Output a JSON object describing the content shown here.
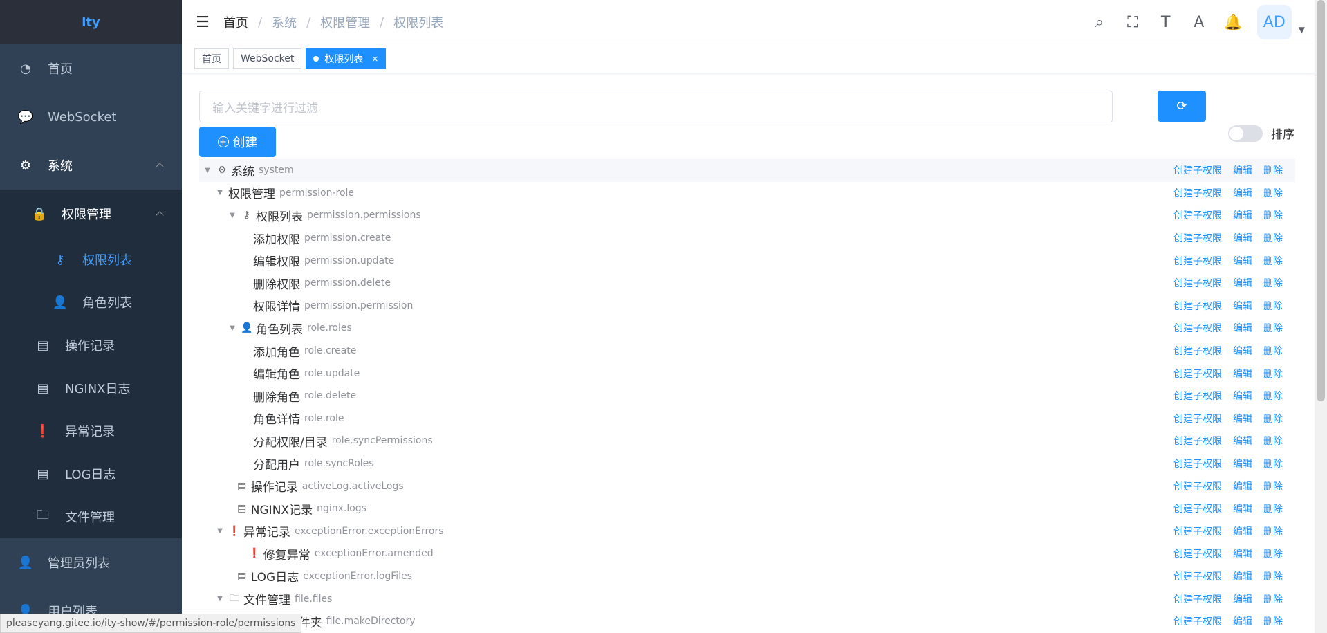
{
  "sidebar": {
    "logo": "lty",
    "items": [
      {
        "label": "首页",
        "icon": "dashboard-icon"
      },
      {
        "label": "WebSocket",
        "icon": "chat-icon"
      },
      {
        "label": "系统",
        "icon": "gear-icon"
      },
      {
        "label": "权限管理",
        "icon": "lock-icon"
      },
      {
        "label": "权限列表",
        "icon": "key-icon"
      },
      {
        "label": "角色列表",
        "icon": "user-icon"
      },
      {
        "label": "操作记录",
        "icon": "document-icon"
      },
      {
        "label": "NGINX日志",
        "icon": "document-icon"
      },
      {
        "label": "异常记录",
        "icon": "warning-icon"
      },
      {
        "label": "LOG日志",
        "icon": "document-icon"
      },
      {
        "label": "文件管理",
        "icon": "folder-icon"
      },
      {
        "label": "管理员列表",
        "icon": "user-icon"
      },
      {
        "label": "用户列表",
        "icon": "user-icon"
      }
    ]
  },
  "header": {
    "breadcrumb": [
      "首页",
      "系统",
      "权限管理",
      "权限列表"
    ],
    "avatar": "AD",
    "icons": [
      "search-icon",
      "fullscreen-icon",
      "font-size-icon",
      "translate-icon",
      "bell-icon"
    ]
  },
  "tags": {
    "items": [
      "首页",
      "WebSocket"
    ],
    "active": "权限列表",
    "close": "×"
  },
  "toolbar": {
    "filter_placeholder": "输入关键字进行过滤",
    "create_label": "创建",
    "sort_label": "排序"
  },
  "tree": {
    "actions": {
      "add_child": "创建子权限",
      "edit": "编辑",
      "delete": "删除"
    },
    "rows": [
      {
        "label": "系统",
        "code": "system"
      },
      {
        "label": "权限管理",
        "code": "permission-role"
      },
      {
        "label": "权限列表",
        "code": "permission.permissions"
      },
      {
        "label": "添加权限",
        "code": "permission.create"
      },
      {
        "label": "编辑权限",
        "code": "permission.update"
      },
      {
        "label": "删除权限",
        "code": "permission.delete"
      },
      {
        "label": "权限详情",
        "code": "permission.permission"
      },
      {
        "label": "角色列表",
        "code": "role.roles"
      },
      {
        "label": "添加角色",
        "code": "role.create"
      },
      {
        "label": "编辑角色",
        "code": "role.update"
      },
      {
        "label": "删除角色",
        "code": "role.delete"
      },
      {
        "label": "角色详情",
        "code": "role.role"
      },
      {
        "label": "分配权限/目录",
        "code": "role.syncPermissions"
      },
      {
        "label": "分配用户",
        "code": "role.syncRoles"
      },
      {
        "label": "操作记录",
        "code": "activeLog.activeLogs"
      },
      {
        "label": "NGINX记录",
        "code": "nginx.logs"
      },
      {
        "label": "异常记录",
        "code": "exceptionError.exceptionErrors"
      },
      {
        "label": "修复异常",
        "code": "exceptionError.amended"
      },
      {
        "label": "LOG日志",
        "code": "exceptionError.logFiles"
      },
      {
        "label": "文件管理",
        "code": "file.files"
      },
      {
        "label": "创建文件夹",
        "code": "file.makeDirectory"
      }
    ]
  },
  "statusbar": {
    "url": "pleaseyang.gitee.io/ity-show/#/permission-role/permissions"
  }
}
